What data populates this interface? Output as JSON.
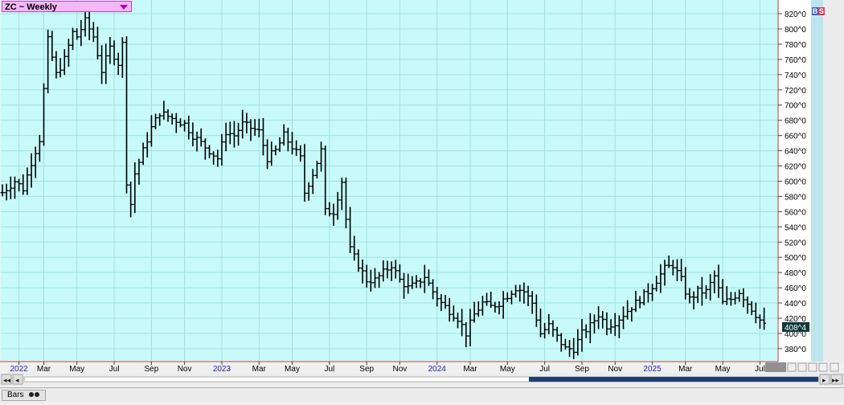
{
  "header": {
    "symbol_label": "ZC ~ Weekly",
    "bs_b": "B",
    "bs_s": "S"
  },
  "footer": {
    "tab_label": "Bars"
  },
  "colors": {
    "plot_bg": "#c8fafa",
    "grid": "#a0e0e0",
    "bars": "#000000",
    "axis_line": "#d04040",
    "date_text": "#2020c0",
    "year_text": "#2020c0",
    "last_price_bg": "#0c3838",
    "bs_b": "#4060c0",
    "bs_s": "#d04060"
  },
  "chart_data": {
    "type": "ohlc",
    "frequency": "weekly",
    "y_ticks": [
      "380^0",
      "400^0",
      "420^0",
      "440^0",
      "460^0",
      "480^0",
      "500^0",
      "520^0",
      "540^0",
      "560^0",
      "580^0",
      "600^0",
      "620^0",
      "640^0",
      "660^0",
      "680^0",
      "700^0",
      "720^0",
      "740^0",
      "760^0",
      "780^0",
      "800^0",
      "820^0"
    ],
    "y_tick_values": [
      380,
      400,
      420,
      440,
      460,
      480,
      500,
      520,
      540,
      560,
      580,
      600,
      620,
      640,
      660,
      680,
      700,
      720,
      740,
      760,
      780,
      800,
      820
    ],
    "ylim": [
      363,
      838
    ],
    "last_price_label": "408^4",
    "last_price": 408.5,
    "x_labels": [
      {
        "label": "2022",
        "index": 4,
        "year": true
      },
      {
        "label": "Mar",
        "index": 10,
        "year": false
      },
      {
        "label": "May",
        "index": 18,
        "year": false
      },
      {
        "label": "Jul",
        "index": 27,
        "year": false
      },
      {
        "label": "Sep",
        "index": 36,
        "year": false
      },
      {
        "label": "Nov",
        "index": 44,
        "year": false
      },
      {
        "label": "2023",
        "index": 53,
        "year": true
      },
      {
        "label": "Mar",
        "index": 62,
        "year": false
      },
      {
        "label": "May",
        "index": 70,
        "year": false
      },
      {
        "label": "Jul",
        "index": 79,
        "year": false
      },
      {
        "label": "Sep",
        "index": 88,
        "year": false
      },
      {
        "label": "Nov",
        "index": 96,
        "year": false
      },
      {
        "label": "2024",
        "index": 105,
        "year": true
      },
      {
        "label": "Mar",
        "index": 113,
        "year": false
      },
      {
        "label": "May",
        "index": 122,
        "year": false
      },
      {
        "label": "Jul",
        "index": 131,
        "year": false
      },
      {
        "label": "Sep",
        "index": 140,
        "year": false
      },
      {
        "label": "Nov",
        "index": 148,
        "year": false
      },
      {
        "label": "2025",
        "index": 157,
        "year": true
      },
      {
        "label": "Mar",
        "index": 165,
        "year": false
      },
      {
        "label": "May",
        "index": 174,
        "year": false
      },
      {
        "label": "Jul",
        "index": 183,
        "year": false
      }
    ],
    "close_path": [
      [
        0,
        585
      ],
      [
        3,
        600
      ],
      [
        5,
        590
      ],
      [
        7,
        625
      ],
      [
        9,
        655
      ],
      [
        11,
        785
      ],
      [
        13,
        740
      ],
      [
        15,
        760
      ],
      [
        17,
        795
      ],
      [
        18,
        790
      ],
      [
        20,
        810
      ],
      [
        22,
        790
      ],
      [
        24,
        745
      ],
      [
        26,
        775
      ],
      [
        28,
        755
      ],
      [
        29,
        780
      ],
      [
        30,
        600
      ],
      [
        31,
        570
      ],
      [
        32,
        610
      ],
      [
        34,
        640
      ],
      [
        36,
        670
      ],
      [
        38,
        690
      ],
      [
        40,
        685
      ],
      [
        42,
        680
      ],
      [
        44,
        675
      ],
      [
        46,
        660
      ],
      [
        48,
        650
      ],
      [
        50,
        640
      ],
      [
        52,
        630
      ],
      [
        54,
        665
      ],
      [
        56,
        660
      ],
      [
        58,
        675
      ],
      [
        60,
        670
      ],
      [
        62,
        665
      ],
      [
        64,
        630
      ],
      [
        66,
        640
      ],
      [
        68,
        660
      ],
      [
        70,
        645
      ],
      [
        72,
        630
      ],
      [
        73,
        585
      ],
      [
        75,
        610
      ],
      [
        77,
        640
      ],
      [
        78,
        560
      ],
      [
        80,
        560
      ],
      [
        82,
        600
      ],
      [
        83,
        550
      ],
      [
        84,
        510
      ],
      [
        86,
        490
      ],
      [
        88,
        470
      ],
      [
        90,
        470
      ],
      [
        92,
        480
      ],
      [
        94,
        490
      ],
      [
        96,
        470
      ],
      [
        98,
        460
      ],
      [
        100,
        465
      ],
      [
        102,
        475
      ],
      [
        104,
        455
      ],
      [
        106,
        440
      ],
      [
        108,
        430
      ],
      [
        110,
        420
      ],
      [
        112,
        400
      ],
      [
        114,
        425
      ],
      [
        116,
        440
      ],
      [
        118,
        435
      ],
      [
        120,
        440
      ],
      [
        122,
        450
      ],
      [
        124,
        460
      ],
      [
        126,
        455
      ],
      [
        128,
        440
      ],
      [
        130,
        400
      ],
      [
        132,
        410
      ],
      [
        134,
        395
      ],
      [
        136,
        380
      ],
      [
        138,
        380
      ],
      [
        140,
        400
      ],
      [
        142,
        410
      ],
      [
        144,
        425
      ],
      [
        146,
        410
      ],
      [
        148,
        415
      ],
      [
        150,
        425
      ],
      [
        152,
        435
      ],
      [
        154,
        445
      ],
      [
        156,
        455
      ],
      [
        158,
        470
      ],
      [
        160,
        485
      ],
      [
        162,
        490
      ],
      [
        164,
        470
      ],
      [
        165,
        455
      ],
      [
        166,
        445
      ],
      [
        168,
        455
      ],
      [
        170,
        455
      ],
      [
        172,
        475
      ],
      [
        174,
        440
      ],
      [
        176,
        445
      ],
      [
        178,
        455
      ],
      [
        180,
        440
      ],
      [
        182,
        425
      ],
      [
        184,
        410
      ]
    ]
  }
}
